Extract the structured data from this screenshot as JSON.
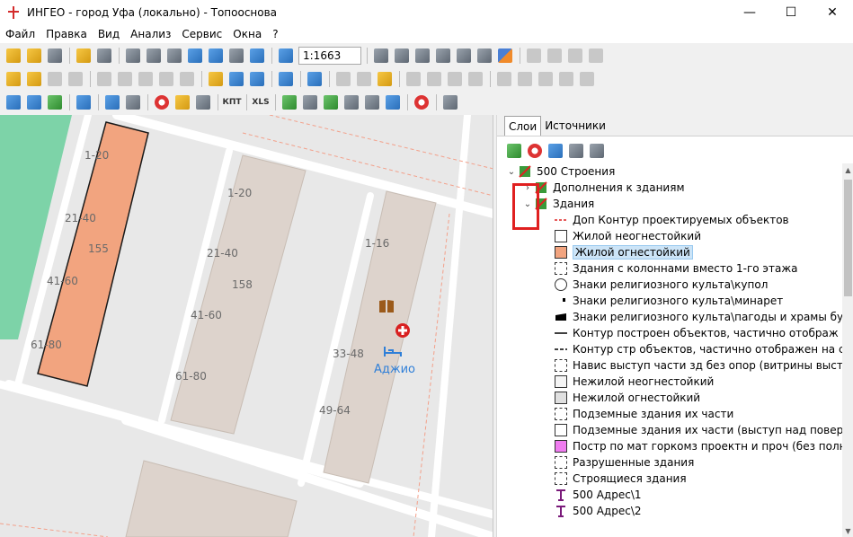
{
  "window": {
    "title": "ИНГЕО - город Уфа (локально) - Топооснова"
  },
  "menu": [
    "Файл",
    "Правка",
    "Вид",
    "Анализ",
    "Сервис",
    "Окна",
    "?"
  ],
  "toolbar": {
    "scale": "1:1663",
    "xls_label": "XLS",
    "kpt_label": "КПТ"
  },
  "map": {
    "labels": [
      "1-20",
      "21-40",
      "155",
      "41-60",
      "61-80",
      "1-20",
      "21-40",
      "158",
      "41-60",
      "61-80",
      "1-16",
      "33-48",
      "49-64"
    ],
    "poi_name": "Аджио"
  },
  "panel": {
    "tabs": [
      "Слои",
      "Источники"
    ],
    "tree": [
      {
        "label": "500 Строения"
      },
      {
        "label": "Дополнения к зданиям"
      },
      {
        "label": "Здания"
      },
      {
        "label": "Доп Контур проектируемых объектов"
      },
      {
        "label": "Жилой неогнестойкий"
      },
      {
        "label": "Жилой огнестойкий"
      },
      {
        "label": "Здания с колоннами вместо 1-го этажа"
      },
      {
        "label": "Знаки религиозного культа\\купол"
      },
      {
        "label": "Знаки религиозного культа\\минарет"
      },
      {
        "label": "Знаки религиозного культа\\пагоды и храмы буддийс"
      },
      {
        "label": "Контур построен объектов, частично отображ на съе"
      },
      {
        "label": "Контур стр объектов, частично отображен на съемке"
      },
      {
        "label": "Навис выступ части зд без опор (витрины выступы)"
      },
      {
        "label": "Нежилой неогнестойкий"
      },
      {
        "label": "Нежилой огнестойкий"
      },
      {
        "label": "Подземные здания их части"
      },
      {
        "label": "Подземные здания их части (выступ над поверхность"
      },
      {
        "label": "Постр по мат горкомз проектн и проч (без полных ха"
      },
      {
        "label": "Разрушенные здания"
      },
      {
        "label": "Строящиеся здания"
      },
      {
        "label": "500 Адрес\\1"
      },
      {
        "label": "500 Адрес\\2"
      }
    ]
  },
  "colors": {
    "building_fill": "#f2a47f",
    "road": "#ffffff",
    "park": "#7dd3a8",
    "accent": "#2f7fd8",
    "highlight": "#e02020"
  }
}
